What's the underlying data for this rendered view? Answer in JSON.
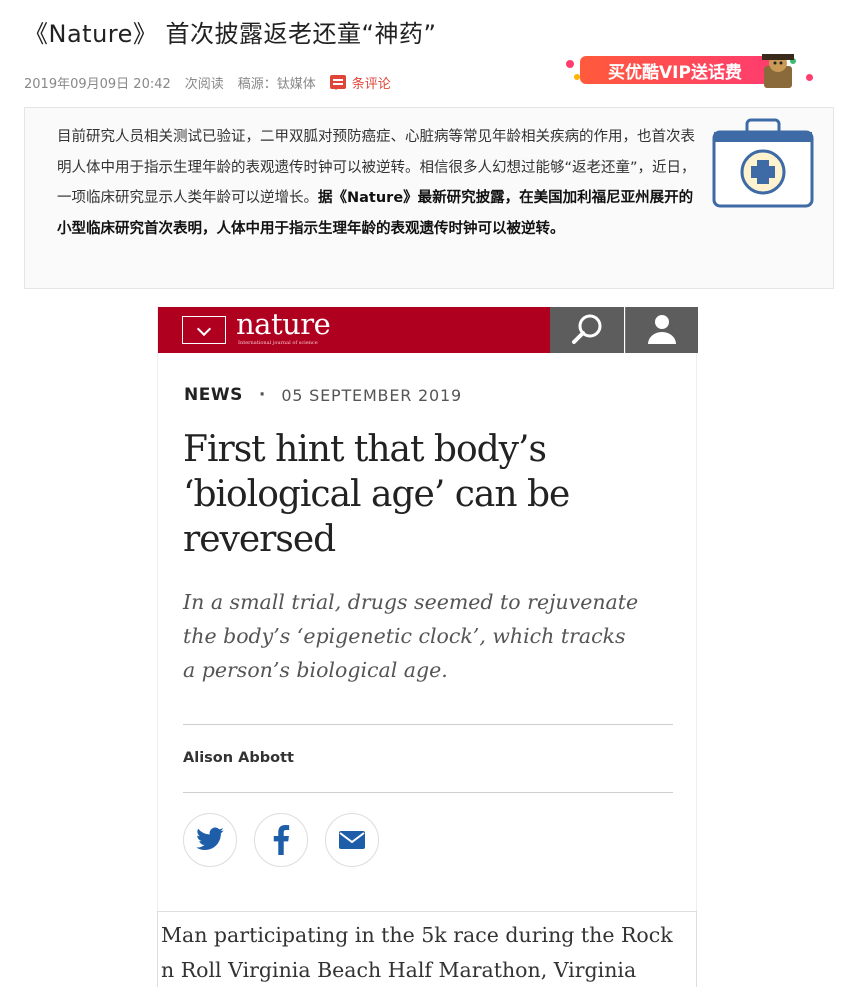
{
  "article": {
    "title": "《Nature》 首次披露返老还童“神药”",
    "date": "2019年09月09日 20:42",
    "read_label": "次阅读",
    "source": "稿源：钛媒体",
    "comment_label": "条评论"
  },
  "banner": {
    "text": "买优酷VIP送话费"
  },
  "summary": {
    "normal": "目前研究人员相关测试已验证，二甲双胍对预防癌症、心脏病等常见年龄相关疾病的作用，也首次表明人体中用于指示生理年龄的表观遗传时钟可以被逆转。相信很多人幻想过能够“返老还童”，近日，一项临床研究显示人类年龄可以逆增长。",
    "bold": "据《Nature》最新研究披露，在美国加利福尼亚州展开的小型临床研究首次表明，人体中用于指示生理年龄的表观遗传时钟可以被逆转。",
    "icon": "first-aid-kit-icon"
  },
  "nature": {
    "logo": "nature",
    "tagline": "International journal of science",
    "section": "NEWS",
    "separator": "·",
    "date": "05 SEPTEMBER 2019",
    "headline": "First hint that body’s ‘biological age’ can be reversed",
    "standfirst": "In a small trial, drugs seemed to rejuvenate the body’s ‘epigenetic clock’, which tracks a person’s biological age.",
    "author": "Alison Abbott",
    "share": [
      "twitter-icon",
      "facebook-icon",
      "email-icon"
    ],
    "colors": {
      "brand_red": "#b00020",
      "header_gray": "#5d5d5d"
    }
  },
  "caption": {
    "text": "Man participating in the 5k race during the Rock n Roll Virginia Beach Half Marathon, Virginia"
  }
}
